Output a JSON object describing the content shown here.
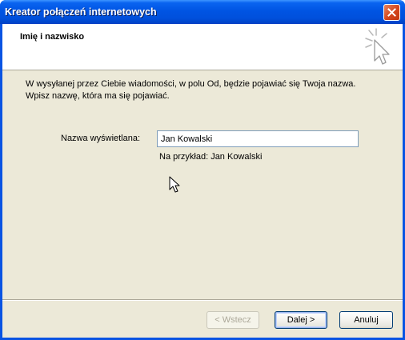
{
  "window": {
    "title": "Kreator połączeń internetowych",
    "close_icon": "close-icon"
  },
  "header": {
    "title": "Imię i nazwisko",
    "icon": "wizard-sparkle-cursor-icon"
  },
  "main": {
    "description_line1": "W wysyłanej przez Ciebie wiadomości, w polu Od, będzie pojawiać się Twoja nazwa.",
    "description_line2": "Wpisz nazwę, która ma się pojawiać.",
    "display_name_label": "Nazwa wyświetlana:",
    "display_name_value": "Jan Kowalski",
    "example_text": "Na przykład: Jan Kowalski"
  },
  "buttons": {
    "back_label": "< Wstecz",
    "next_label": "Dalej >",
    "cancel_label": "Anuluj"
  },
  "colors": {
    "titlebar": "#0054e3",
    "dialog_face": "#ece9d8",
    "close_button": "#d4451c"
  }
}
